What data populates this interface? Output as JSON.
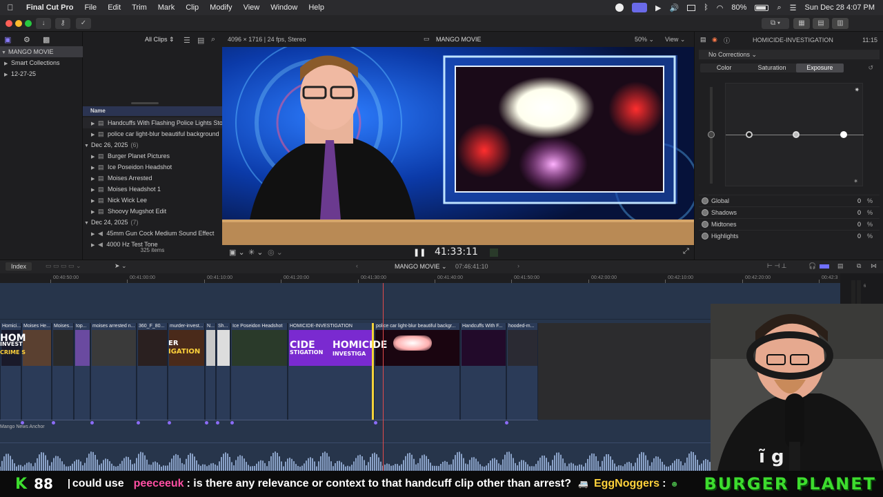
{
  "menubar": {
    "app": "Final Cut Pro",
    "items": [
      "File",
      "Edit",
      "Trim",
      "Mark",
      "Clip",
      "Modify",
      "View",
      "Window",
      "Help"
    ],
    "battery": "80%",
    "datetime": "Sun Dec 28  4:07 PM"
  },
  "libraries": {
    "root": "MANGO MOVIE",
    "items": [
      "Smart Collections",
      "12-27-25"
    ]
  },
  "browser": {
    "filter": "All Clips",
    "column_header": "Name",
    "items_count": "325 items",
    "rows": [
      {
        "kind": "clip",
        "label": "Handcuffs With Flashing Police Lights Sto"
      },
      {
        "kind": "clip",
        "label": "police car light-blur beautiful background"
      },
      {
        "kind": "group",
        "label": "Dec 26, 2025",
        "count": "(6)"
      },
      {
        "kind": "clip",
        "label": "Burger Planet Pictures"
      },
      {
        "kind": "clip",
        "label": "Ice Poseidon Headshot"
      },
      {
        "kind": "clip",
        "label": "Moises Arrested"
      },
      {
        "kind": "clip",
        "label": "Moises Headshot 1"
      },
      {
        "kind": "clip",
        "label": "Nick Wick Lee"
      },
      {
        "kind": "clip",
        "label": "Shoovy Mugshot Edit"
      },
      {
        "kind": "group",
        "label": "Dec 24, 2025",
        "count": "(7)"
      },
      {
        "kind": "audio",
        "label": "45mm Gun Cock Medium Sound Effect"
      },
      {
        "kind": "audio",
        "label": "4000 Hz Test Tone"
      }
    ]
  },
  "viewer": {
    "format": "4096 × 1716 | 24 fps, Stereo",
    "project": "MANGO MOVIE",
    "zoom": "50%",
    "view_menu": "View",
    "timecode": "41:33:11"
  },
  "inspector": {
    "clip_name": "HOMICIDE-INVESTIGATION",
    "duration": "11:15",
    "corrections": "No Corrections",
    "tabs": [
      "Color",
      "Saturation",
      "Exposure"
    ],
    "active_tab": "Exposure",
    "params": [
      {
        "label": "Global",
        "value": "0",
        "unit": "%"
      },
      {
        "label": "Shadows",
        "value": "0",
        "unit": "%"
      },
      {
        "label": "Midtones",
        "value": "0",
        "unit": "%"
      },
      {
        "label": "Highlights",
        "value": "0",
        "unit": "%"
      }
    ]
  },
  "timeline": {
    "index_label": "Index",
    "project": "MANGO MOVIE",
    "duration": "07:46:41:10",
    "ruler": [
      "00:40:50:00",
      "00:41:00:00",
      "00:41:10:00",
      "00:41:20:00",
      "00:41:30:00",
      "00:41:40:00",
      "00:41:50:00",
      "00:42:00:00",
      "00:42:10:00",
      "00:42:20:00",
      "00:42:3"
    ],
    "clips": [
      "Homici...",
      "Moises He...",
      "Moises...",
      "top...",
      "moises arrested n...",
      "360_F_80...",
      "murder-invest...",
      "N...",
      "Sh...",
      "Ice Poseidon Headshot",
      "HOMICIDE-INVESTIGATION",
      "police car light-blur beautiful backgr...",
      "Handcuffs With F...",
      "hooded-m..."
    ],
    "thumb_texts": [
      "HOM",
      "INVEST",
      "CRIME S",
      "ER",
      "IGATION",
      "CIDE",
      "STIGATION",
      "HOMICIDE",
      "INVESTIGA"
    ],
    "audio_label": "Mango News Anchor"
  },
  "ticker": {
    "points": "88",
    "fragment": "could use",
    "user1": "peeceeuk",
    "msg1": ": is there any relevance or context to that handcuff clip other than arrest?",
    "user2": "EggNoggers",
    "msg2": ":",
    "brand": "BURGER PLANET"
  },
  "colors": {
    "accent": "#6a6ae8",
    "clip_purple": "#8b5cf6",
    "playhead": "#e34b4b",
    "ticker_green": "#3ddc2e",
    "user_pink": "#ff4fa3",
    "user_yellow": "#ffd23b"
  }
}
